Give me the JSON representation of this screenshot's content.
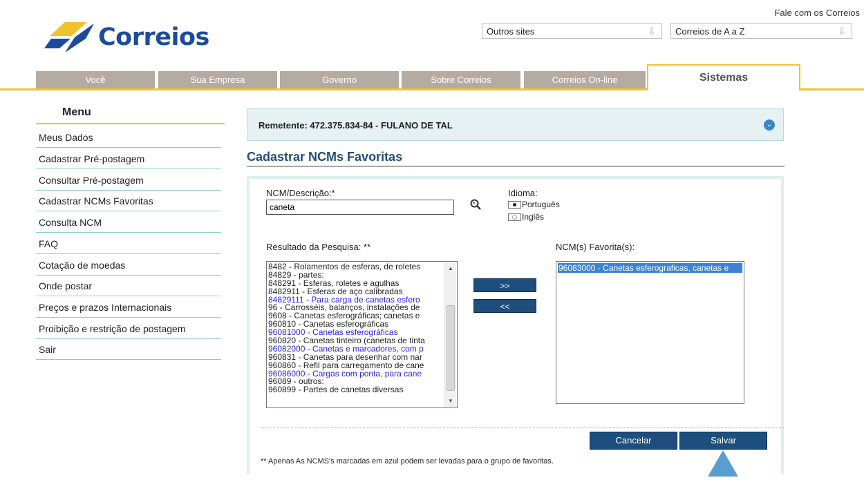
{
  "header": {
    "logo_text": "Correios",
    "contact_link": "Fale com os Correios",
    "selects": [
      {
        "value": "Outros sites"
      },
      {
        "value": "Correios de A a Z"
      }
    ]
  },
  "nav": {
    "tabs": [
      "Você",
      "Sua Empresa",
      "Governo",
      "Sobre Correios",
      "Correios On-line"
    ],
    "active_tab": "Sistemas"
  },
  "sidebar": {
    "title": "Menu",
    "items": [
      "Meus Dados",
      "Cadastrar Pré-postagem",
      "Consultar Pré-postagem",
      "Cadastrar NCMs Favoritas",
      "Consulta NCM",
      "FAQ",
      "Cotação de moedas",
      "Onde postar",
      "Preços e prazos Internacionais",
      "Proibição e restrição de postagem",
      "Sair"
    ]
  },
  "remetente": {
    "text": "Remetente: 472.375.834-84 - FULANO DE TAL"
  },
  "page_title": "Cadastrar NCMs Favoritas",
  "form": {
    "ncm_label": "NCM/Descrição:*",
    "ncm_value": "caneta",
    "idioma_label": "Idioma:",
    "idioma_options": [
      {
        "label": "Português",
        "selected": true
      },
      {
        "label": "Inglês",
        "selected": false
      }
    ],
    "results_label": "Resultado da Pesquisa: **",
    "favorites_label": "NCM(s) Favorita(s):",
    "results": [
      {
        "text": "8482 - Rolamentos de esferas, de roletes",
        "blue": false
      },
      {
        "text": "84829 - partes:",
        "blue": false
      },
      {
        "text": "848291 - Esferas, roletes e agulhas",
        "blue": false
      },
      {
        "text": "8482911 - Esferas de aço calibradas",
        "blue": false
      },
      {
        "text": "84829111 - Para carga de canetas esfero",
        "blue": true
      },
      {
        "text": "96 - Carrosséis, balanços, instalações de",
        "blue": false
      },
      {
        "text": "9608 - Canetas esferográficas; canetas e",
        "blue": false
      },
      {
        "text": "960810 - Canetas esferográficas",
        "blue": false
      },
      {
        "text": "96081000 - Canetas esferográficas",
        "blue": true
      },
      {
        "text": "960820 - Canetas tinteiro (canetas de tinta",
        "blue": false
      },
      {
        "text": "96082000 - Canetas e marcadores, com p",
        "blue": true
      },
      {
        "text": "960831 - Canetas para desenhar com nar",
        "blue": false
      },
      {
        "text": "960860 - Refil para carregamento de cane",
        "blue": false
      },
      {
        "text": "96086000 - Cargas com ponta, para cane",
        "blue": true
      },
      {
        "text": "96089 - outros:",
        "blue": false
      },
      {
        "text": "960899 - Partes de canetas diversas",
        "blue": false
      }
    ],
    "favorites": [
      "96083000 - Canetas esferograficas, canetas e"
    ],
    "add_button": ">>",
    "remove_button": "<<",
    "cancel_button": "Cancelar",
    "save_button": "Salvar",
    "note": "** Apenas As NCMS's marcadas em azul podem ser levadas para o grupo de favoritas."
  },
  "colors": {
    "brand_blue": "#1d4e7e",
    "accent_yellow": "#f1c230",
    "highlight_blue": "#2626e6"
  }
}
